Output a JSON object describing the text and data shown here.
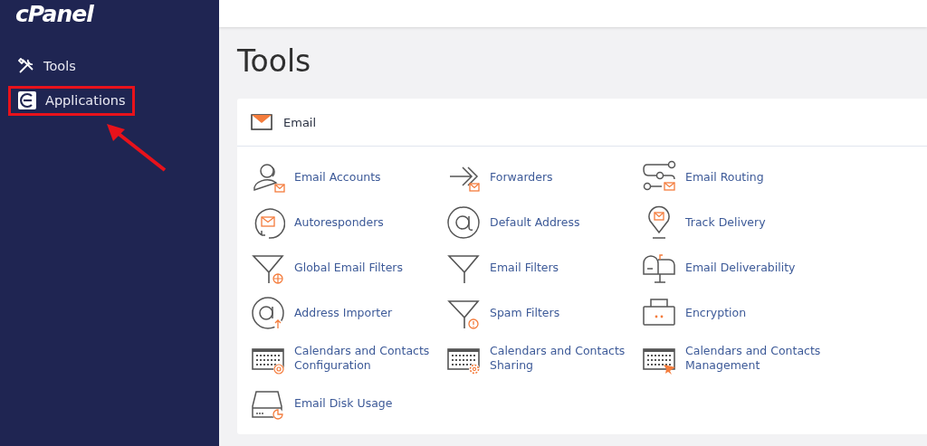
{
  "logo": "cPanel",
  "sidebar": {
    "items": [
      {
        "label": "Tools",
        "highlighted": false
      },
      {
        "label": "Applications",
        "highlighted": true
      }
    ]
  },
  "annotation_arrow": true,
  "page_title": "Tools",
  "section": {
    "title": "Email",
    "items": [
      {
        "label": "Email Accounts"
      },
      {
        "label": "Forwarders"
      },
      {
        "label": "Email Routing"
      },
      {
        "label": "Autoresponders"
      },
      {
        "label": "Default Address"
      },
      {
        "label": "Track Delivery"
      },
      {
        "label": "Global Email Filters"
      },
      {
        "label": "Email Filters"
      },
      {
        "label": "Email Deliverability"
      },
      {
        "label": "Address Importer"
      },
      {
        "label": "Spam Filters"
      },
      {
        "label": "Encryption"
      },
      {
        "label": "Calendars and Contacts Configuration"
      },
      {
        "label": "Calendars and Contacts Sharing"
      },
      {
        "label": "Calendars and Contacts Management"
      },
      {
        "label": "Email Disk Usage"
      }
    ]
  }
}
